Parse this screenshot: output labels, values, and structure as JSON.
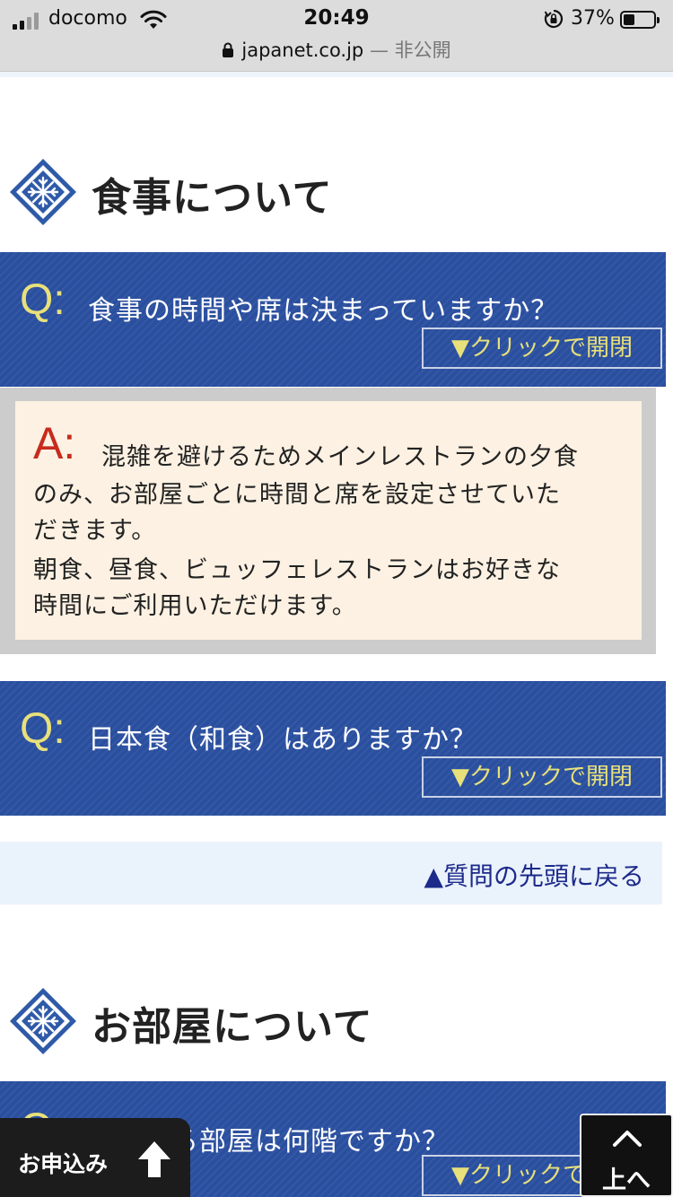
{
  "status_bar": {
    "carrier": "docomo",
    "time": "20:49",
    "battery_percent": "37%",
    "battery_level": 0.37,
    "url": "japanet.co.jp",
    "url_separator": "—",
    "url_status": "非公開"
  },
  "sections": [
    {
      "title": "食事について",
      "questions": [
        {
          "q_mark": "Q:",
          "question": "食事の時間や席は決まっていますか？",
          "toggle_label": "▼クリックで開閉",
          "expanded": true,
          "a_mark": "A:",
          "answer_lines": [
            "混雑を避けるためメインレストランの夕食",
            "のみ、お部屋ごとに時間と席を設定させていた",
            "だきます。",
            "朝食、昼食、ビュッフェレストランはお好きな",
            "時間にご利用いただけます。"
          ]
        },
        {
          "q_mark": "Q:",
          "question": "日本食（和食）はありますか？",
          "toggle_label": "▼クリックで開閉",
          "expanded": false
        }
      ],
      "back_to_top": "▲質問の先頭に戻る"
    },
    {
      "title": "お部屋について",
      "questions": [
        {
          "q_mark": "Q:",
          "question": "宿泊する部屋は何階ですか？",
          "toggle_label": "▼クリックで開閉",
          "expanded": false
        }
      ]
    }
  ],
  "bottom_bar": {
    "apply_label": "お申込み",
    "apply_icon": "up-arrow-icon",
    "top_label": "上へ",
    "top_icon": "chevron-up-icon"
  },
  "colors": {
    "question_bg": "#2a4f9f",
    "q_mark": "#e8e07a",
    "a_mark": "#c62b1e",
    "answer_bg": "#fcf1e2",
    "link": "#1c2a8a"
  }
}
